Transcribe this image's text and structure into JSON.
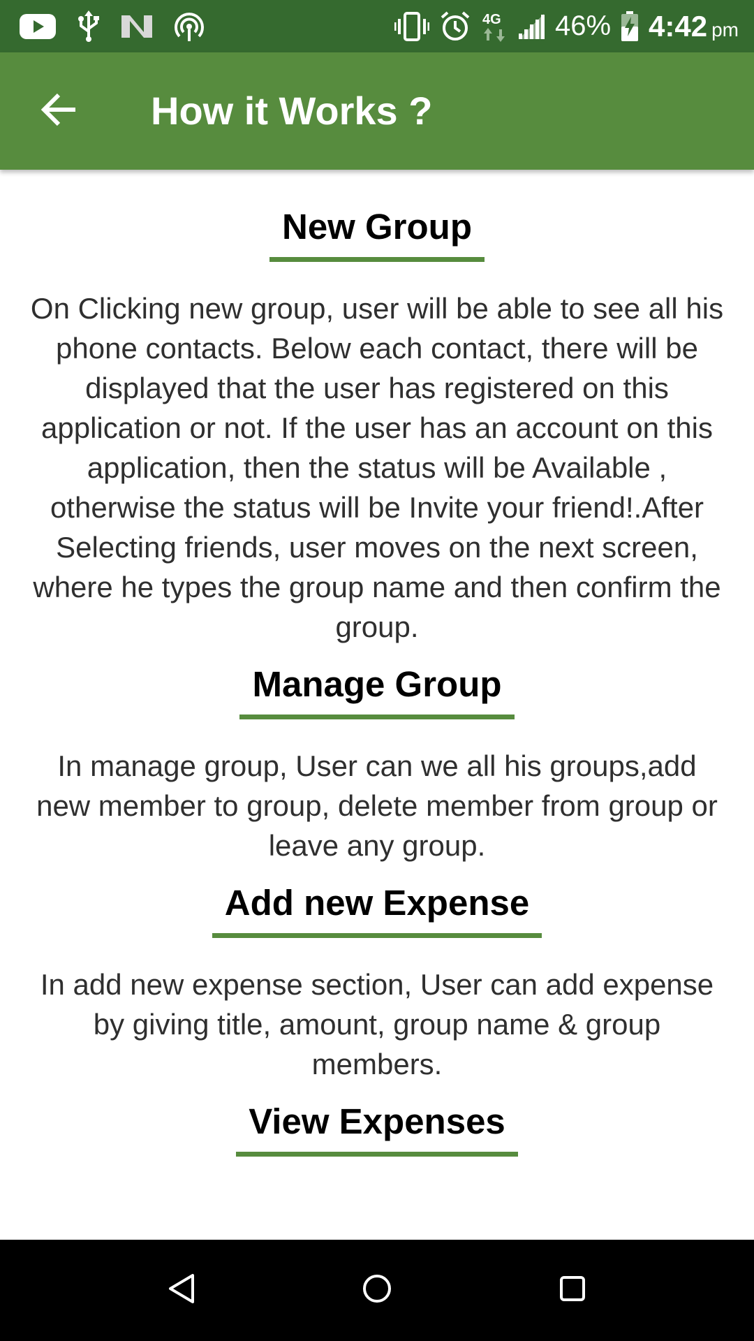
{
  "status_bar": {
    "battery_percent": "46%",
    "time": "4:42",
    "ampm": "pm",
    "icons": [
      "youtube-icon",
      "usb-icon",
      "n-logo-icon",
      "hotspot-icon",
      "vibrate-icon",
      "alarm-icon",
      "4g-data-icon",
      "signal-icon",
      "battery-charging-icon"
    ]
  },
  "app_bar": {
    "title": "How it Works ?",
    "back_icon": "arrow-back-icon",
    "color": "#578c3e"
  },
  "sections": [
    {
      "heading": "New Group",
      "body": "On Clicking new group, user will be able to see all his phone contacts. Below each contact, there will be displayed that the user has registered on this application or not. If the user has an account on this application, then the status will be Available , otherwise the status will be Invite your friend!.After Selecting friends, user moves on the next screen, where he types the group name and then confirm the group."
    },
    {
      "heading": "Manage Group",
      "body": "In manage group, User can we all his groups,add new member to group, delete member from group or leave any group."
    },
    {
      "heading": "Add new Expense",
      "body": "In add new expense section, User can add expense by giving title, amount, group name & group members."
    },
    {
      "heading": "View Expenses",
      "body": ""
    }
  ],
  "nav_bar": {
    "back_icon": "nav-back-icon",
    "home_icon": "nav-home-icon",
    "recents_icon": "nav-recents-icon"
  },
  "colors": {
    "status_bar": "#356a2f",
    "accent": "#578c3e",
    "text": "#2f2f2f"
  }
}
